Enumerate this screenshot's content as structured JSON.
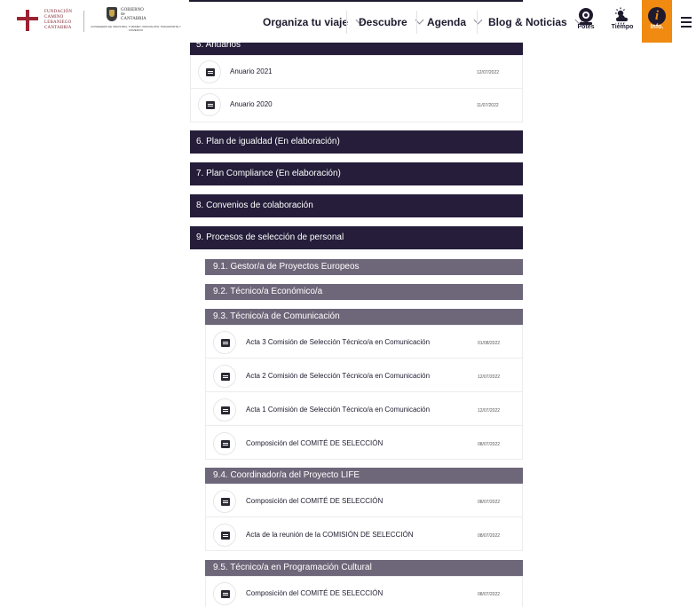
{
  "header": {
    "logo1_lines": [
      "FUNDACIÓN",
      "CAMINO",
      "LEBANIEGO",
      "CANTABRIA"
    ],
    "logo2_lines": [
      "GOBIERNO",
      "de",
      "CANTABRIA"
    ],
    "logo2_sub": "CONSEJERÍA DE INDUSTRIA, TURISMO, INNOVACIÓN, TRANSPORTE Y COMERCIO",
    "nav": [
      "Organiza tu viaje",
      "Descubre",
      "Agenda",
      "Blog & Noticias"
    ],
    "utils": [
      {
        "label": "Potes",
        "icon": "webcam-icon"
      },
      {
        "label": "Tiempo",
        "icon": "weather-icon"
      },
      {
        "label": "Info.",
        "icon": "info-icon"
      }
    ],
    "accent_color": "#f08a10"
  },
  "sections": [
    {
      "label": "5. Anuarios"
    },
    {
      "label": "6. Plan de igualdad (En elaboración)"
    },
    {
      "label": "7. Plan Compliance (En elaboración)"
    },
    {
      "label": "8. Convenios de colaboración"
    },
    {
      "label": "9. Procesos de selección de personal"
    }
  ],
  "anuarios": [
    {
      "title": "Anuario 2021",
      "date": "12/07/2022"
    },
    {
      "title": "Anuario 2020",
      "date": "11/07/2022"
    }
  ],
  "subsections": [
    {
      "label": "9.1. Gestor/a de Proyectos Europeos"
    },
    {
      "label": "9.2. Técnico/a Económico/a"
    },
    {
      "label": "9.3. Técnico/a de Comunicación"
    },
    {
      "label": "9.4. Coordinador/a del Proyecto LIFE"
    },
    {
      "label": "9.5. Técnico/a en Programación Cultural"
    }
  ],
  "docs_9_3": [
    {
      "title": "Acta 3 Comisión de Selección Técnico/a en Comunicación",
      "date": "01/08/2022"
    },
    {
      "title": "Acta 2 Comisión de Selección Técnico/a en Comunicación",
      "date": "12/07/2022"
    },
    {
      "title": "Acta 1 Comisión de Selección Técnico/a en Comunicación",
      "date": "12/07/2022"
    },
    {
      "title": "Composición del COMITÉ DE SELECCIÓN",
      "date": "08/07/2022"
    }
  ],
  "docs_9_4": [
    {
      "title": "Composición del COMITÉ DE SELECCIÓN",
      "date": "08/07/2022"
    },
    {
      "title": "Acta de la reunión de la COMISIÓN DE SELECCIÓN",
      "date": "08/07/2022"
    }
  ],
  "docs_9_5": [
    {
      "title": "Composición del COMITÉ DE SELECCIÓN",
      "date": "08/07/2022"
    }
  ]
}
